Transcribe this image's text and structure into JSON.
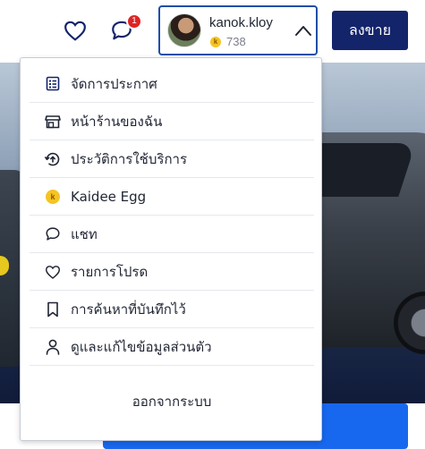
{
  "header": {
    "notification_count": "1",
    "user": {
      "name": "kanok.kloy",
      "coins": "738",
      "coin_symbol": "k"
    },
    "sell_button_label": "ลงขาย"
  },
  "menu": {
    "items": [
      {
        "label": "จัดการประกาศ",
        "icon": "list-icon"
      },
      {
        "label": "หน้าร้านของฉัน",
        "icon": "store-icon"
      },
      {
        "label": "ประวัติการใช้บริการ",
        "icon": "history-icon"
      },
      {
        "label": "Kaidee Egg",
        "icon": "coin-icon"
      },
      {
        "label": "แชท",
        "icon": "chat-icon"
      },
      {
        "label": "รายการโปรด",
        "icon": "heart-icon"
      },
      {
        "label": "การค้นหาที่บันทึกไว้",
        "icon": "bookmark-icon"
      },
      {
        "label": "ดูและแก้ไขข้อมูลส่วนตัว",
        "icon": "person-icon"
      }
    ],
    "logout_label": "ออกจากระบบ",
    "coin_symbol": "k"
  },
  "colors": {
    "sell_button": "#13246b",
    "badge": "#e02424",
    "user_border": "#1e4ea8",
    "cta_blue": "#1768ef"
  }
}
